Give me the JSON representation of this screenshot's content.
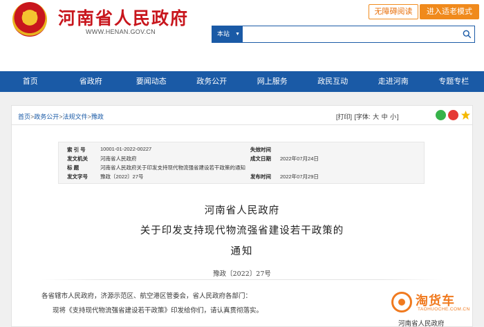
{
  "header": {
    "site_title": "河南省人民政府",
    "site_url": "WWW.HENAN.GOV.CN",
    "accessibility_label": "无障碍阅读",
    "elder_mode_label": "进入适老模式",
    "search_scope": "本站",
    "search_value": ""
  },
  "nav": {
    "items": [
      "首页",
      "省政府",
      "要闻动态",
      "政务公开",
      "网上服务",
      "政民互动",
      "走进河南",
      "专题专栏"
    ]
  },
  "breadcrumb": [
    "首页",
    "政务公开",
    "法规文件",
    "豫政"
  ],
  "breadcrumb_sep": ">",
  "tools": {
    "print": "[打印]",
    "font_label": "[字体:",
    "font_large": "大",
    "font_medium": "中",
    "font_small": "小",
    "font_close": "]"
  },
  "info": {
    "index_label": "索 引 号",
    "index_value": "10001-01-2022-00227",
    "issuer_label": "发文机关",
    "issuer_value": "河南省人民政府",
    "subject_label": "标    题",
    "subject_value": "河南省人民政府关于印发支持现代物流强省建设若干政策的通知",
    "docno_label": "发文字号",
    "docno_value": "豫政〔2022〕27号",
    "expire_label": "失效时间",
    "expire_value": "",
    "written_label": "成文日期",
    "written_value": "2022年07月24日",
    "publish_label": "发布时间",
    "publish_value": "2022年07月29日"
  },
  "document": {
    "title_line1": "河南省人民政府",
    "title_line2": "关于印发支持现代物流强省建设若干政策的",
    "title_line3": "通知",
    "doc_number": "豫政〔2022〕27号",
    "para1": "各省辖市人民政府，济源示范区、航空港区管委会，省人民政府各部门：",
    "para2": "现将《支持现代物流强省建设若干政策》印发给你们，请认真贯彻落实。",
    "footer_issuer": "河南省人民政府"
  },
  "watermark": {
    "brand": "淘货车",
    "url": "TAOHUOCHE.COM.CN"
  },
  "colors": {
    "brand_red": "#c8161d",
    "nav_blue": "#1a5aa6",
    "accent_orange": "#f08a1c"
  }
}
